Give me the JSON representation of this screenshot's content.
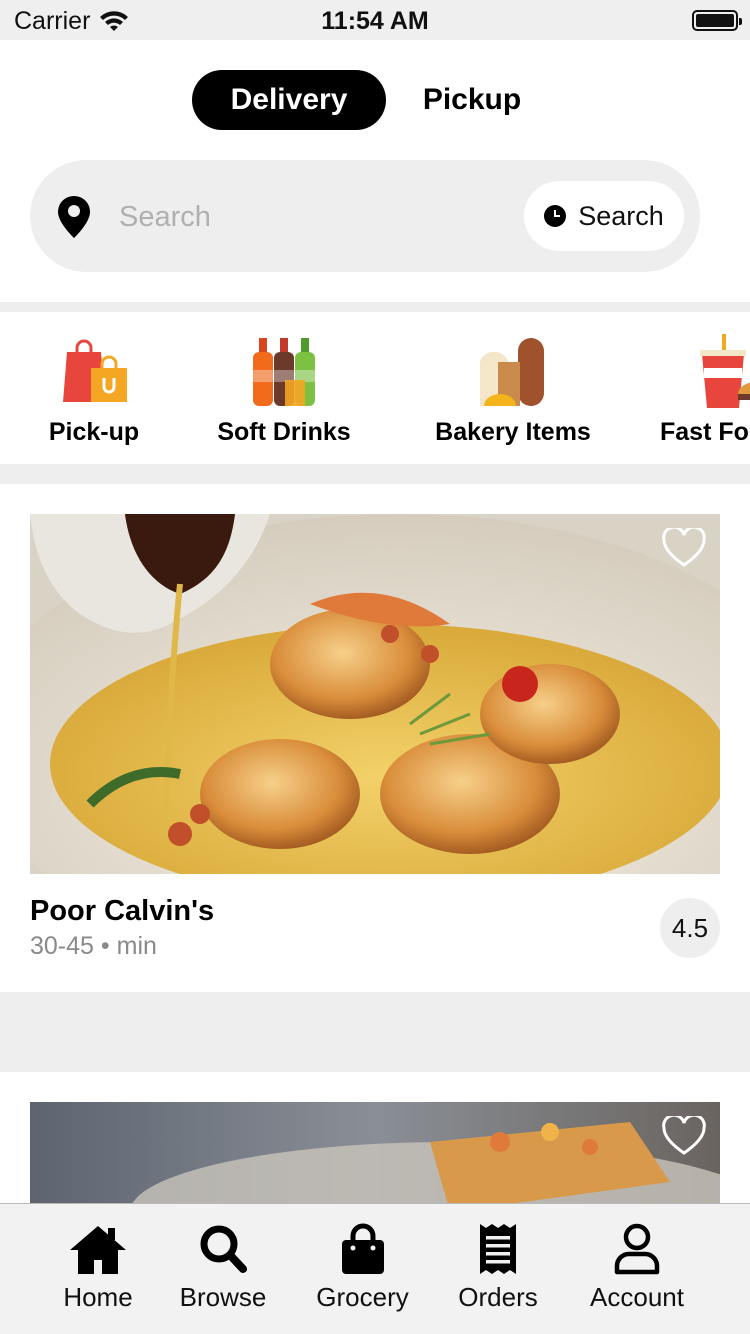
{
  "status_bar": {
    "carrier": "Carrier",
    "time": "11:54 AM"
  },
  "mode_toggle": {
    "delivery": "Delivery",
    "pickup": "Pickup"
  },
  "search": {
    "placeholder": "Search",
    "schedule_label": "Search"
  },
  "categories": [
    {
      "label": "Pick-up",
      "icon": "shopping-bags-icon"
    },
    {
      "label": "Soft Drinks",
      "icon": "soda-bottles-icon"
    },
    {
      "label": "Bakery Items",
      "icon": "bread-icon"
    },
    {
      "label": "Fast Fo",
      "icon": "fast-food-icon"
    }
  ],
  "restaurants": [
    {
      "name": "Poor Calvin's",
      "time": "30-45",
      "unit": "min",
      "rating": "4.5",
      "favorited": false
    }
  ],
  "tab_bar": {
    "items": [
      {
        "label": "Home",
        "icon": "home-icon"
      },
      {
        "label": "Browse",
        "icon": "search-icon"
      },
      {
        "label": "Grocery",
        "icon": "shopping-bag-icon"
      },
      {
        "label": "Orders",
        "icon": "receipt-icon"
      },
      {
        "label": "Account",
        "icon": "user-icon"
      }
    ]
  },
  "colors": {
    "accent": "#000000",
    "surface": "#eeeeee",
    "muted_text": "#8a8a8a"
  }
}
